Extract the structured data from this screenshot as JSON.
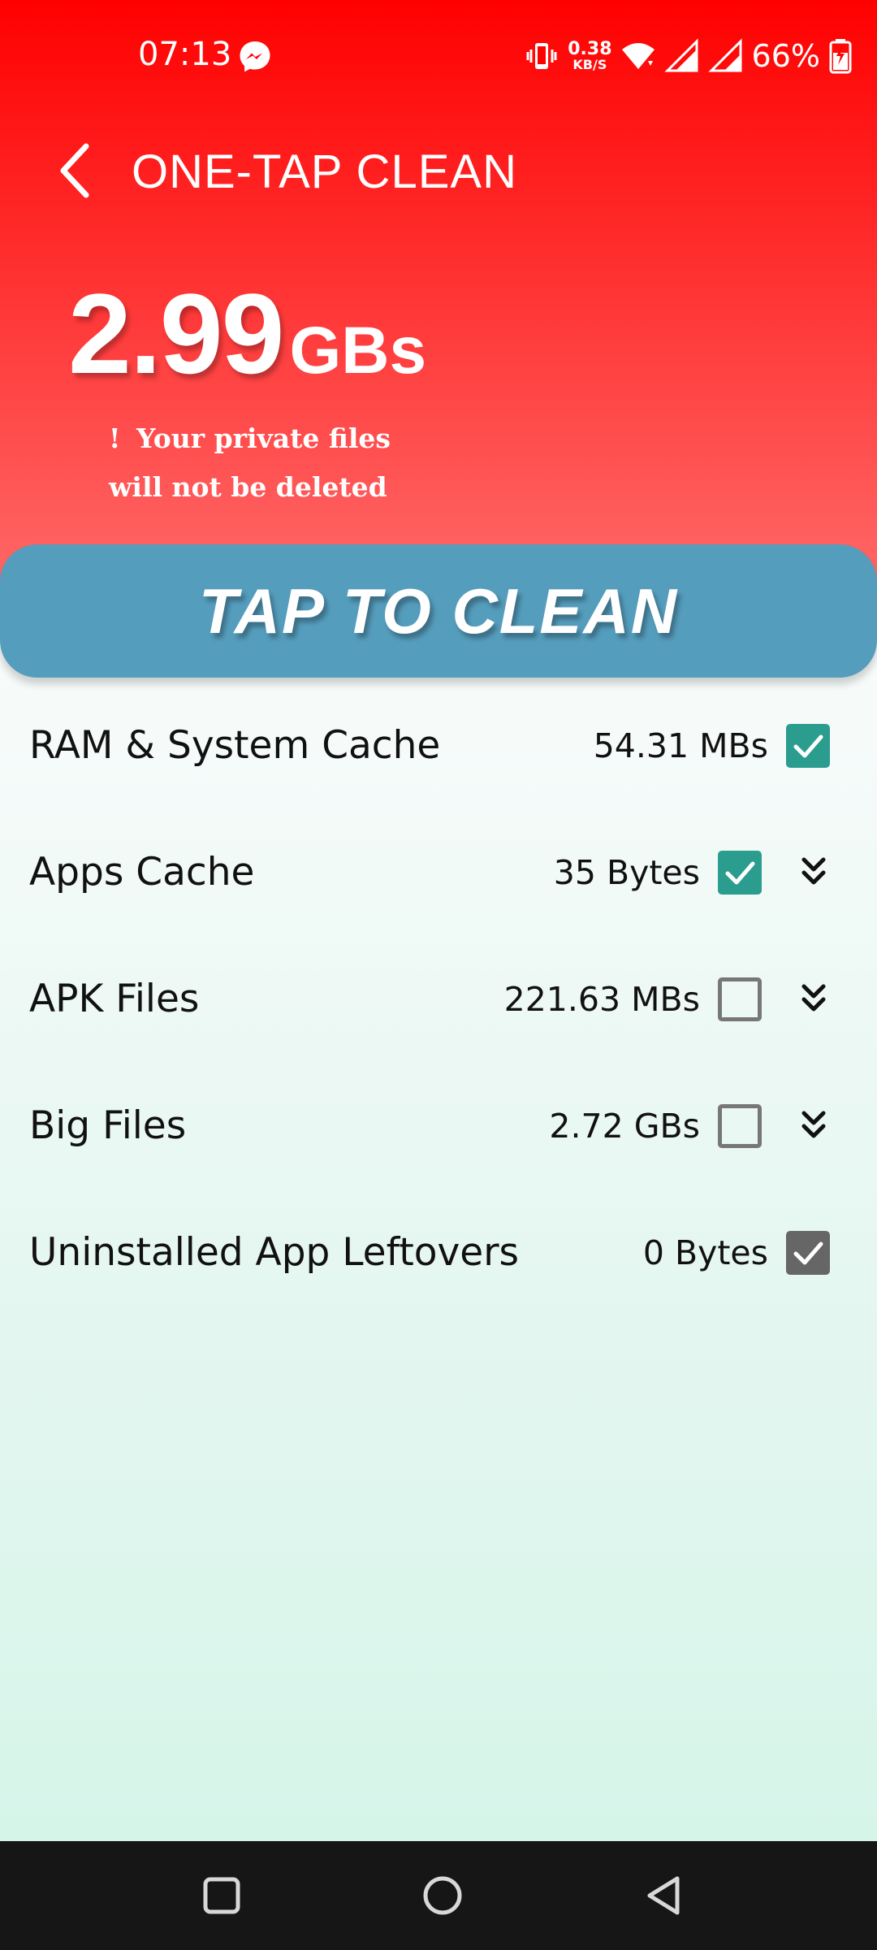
{
  "status_bar": {
    "time": "07:13",
    "net_speed_value": "0.38",
    "net_speed_unit": "KB/S",
    "battery_percent": "66%"
  },
  "header": {
    "title": "ONE-TAP CLEAN",
    "total_size_value": "2.99",
    "total_size_unit": "GBs",
    "note_mark": "!",
    "note_text": "Your private files will not be deleted"
  },
  "clean_button": {
    "label": "TAP TO CLEAN"
  },
  "items": [
    {
      "label": "RAM & System Cache",
      "size": "54.31 MBs",
      "checked": true,
      "expandable": false
    },
    {
      "label": "Apps Cache",
      "size": "35 Bytes",
      "checked": true,
      "expandable": true
    },
    {
      "label": "APK Files",
      "size": "221.63 MBs",
      "checked": false,
      "expandable": true
    },
    {
      "label": "Big Files",
      "size": "2.72 GBs",
      "checked": false,
      "expandable": true
    },
    {
      "label": "Uninstalled App Leftovers",
      "size": "0 Bytes",
      "checked": true,
      "disabled": true,
      "expandable": false
    }
  ],
  "colors": {
    "header_red": "#ff0000",
    "button_blue": "#559dbd",
    "checkbox_teal": "#2a9d8f",
    "navbar": "#161616"
  },
  "icons": {
    "back": "back-arrow-icon",
    "messenger": "messenger-icon",
    "expand": "chevron-double-down-icon"
  }
}
